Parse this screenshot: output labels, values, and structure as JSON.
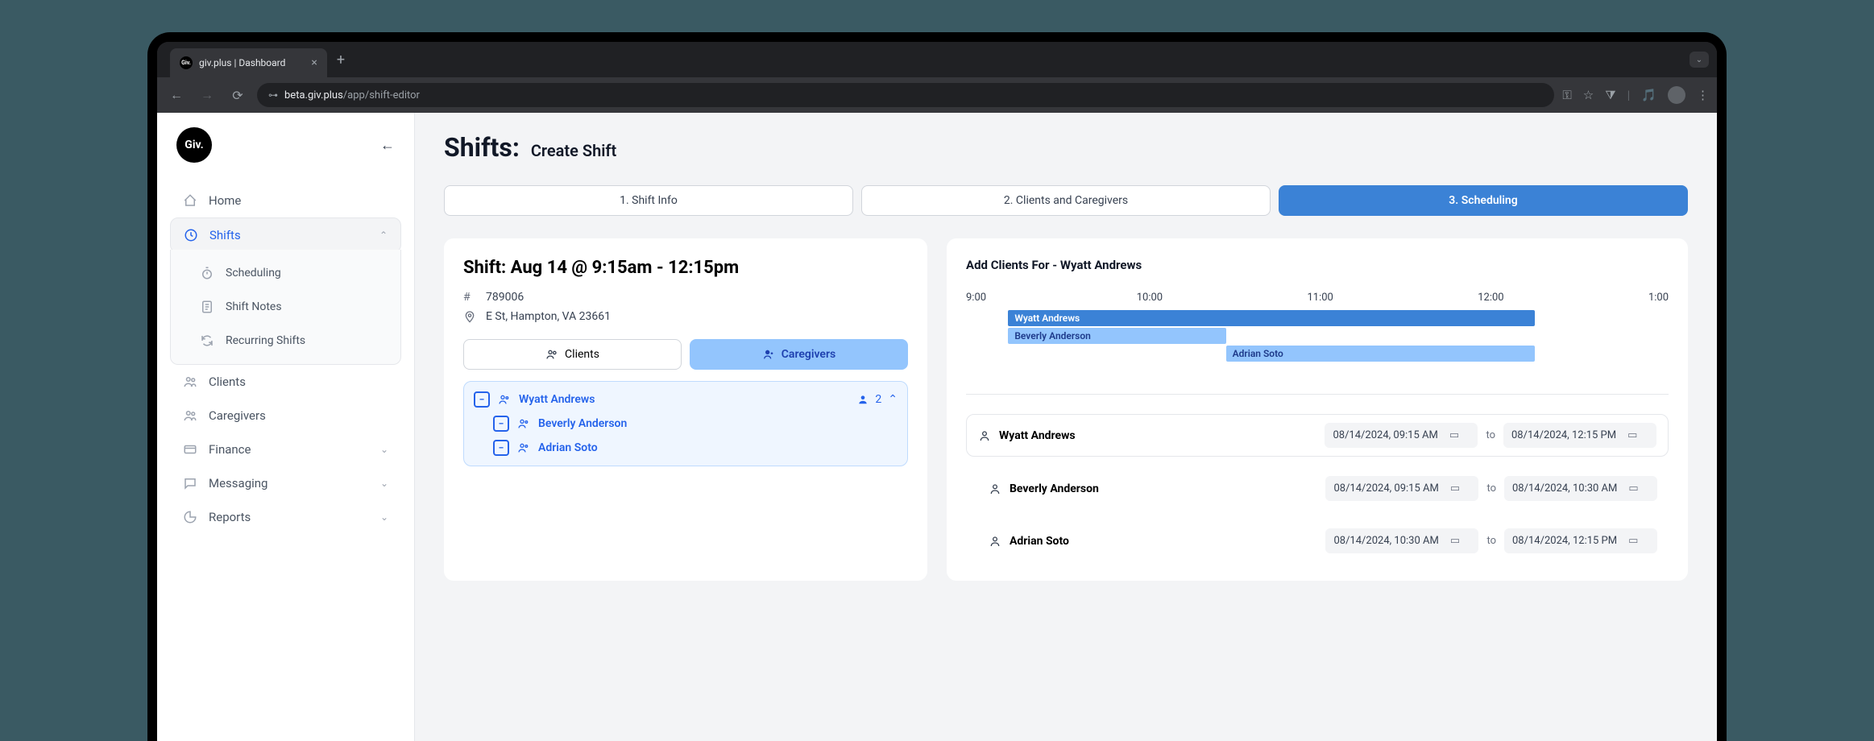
{
  "browser": {
    "tab_title": "giv.plus | Dashboard",
    "url_host": "beta.giv.plus",
    "url_path": "/app/shift-editor"
  },
  "logo_text": "Giv.",
  "sidebar": {
    "items": [
      {
        "label": "Home"
      },
      {
        "label": "Shifts"
      },
      {
        "label": "Clients"
      },
      {
        "label": "Caregivers"
      },
      {
        "label": "Finance"
      },
      {
        "label": "Messaging"
      },
      {
        "label": "Reports"
      }
    ],
    "shifts_sub": [
      {
        "label": "Scheduling"
      },
      {
        "label": "Shift Notes"
      },
      {
        "label": "Recurring Shifts"
      }
    ]
  },
  "page": {
    "title": "Shifts:",
    "subtitle": "Create Shift"
  },
  "steps": [
    {
      "label": "1. Shift Info"
    },
    {
      "label": "2. Clients and Caregivers"
    },
    {
      "label": "3. Scheduling"
    }
  ],
  "shift": {
    "title": "Shift: Aug 14 @ 9:15am - 12:15pm",
    "id": "789006",
    "address": "E St, Hampton, VA 23661"
  },
  "toggle": {
    "clients": "Clients",
    "caregivers": "Caregivers"
  },
  "group": {
    "lead": "Wyatt Andrews",
    "count": "2",
    "members": [
      {
        "name": "Beverly Anderson"
      },
      {
        "name": "Adrian Soto"
      }
    ]
  },
  "right": {
    "title": "Add Clients For - Wyatt Andrews",
    "time_labels": [
      "9:00",
      "10:00",
      "11:00",
      "12:00",
      "1:00"
    ],
    "bars": [
      {
        "name": "Wyatt Andrews"
      },
      {
        "name": "Beverly Anderson"
      },
      {
        "name": "Adrian Soto"
      }
    ]
  },
  "time_rows": [
    {
      "name": "Wyatt Andrews",
      "start": "08/14/2024, 09:15 AM",
      "to": "to",
      "end": "08/14/2024, 12:15 PM"
    },
    {
      "name": "Beverly Anderson",
      "start": "08/14/2024, 09:15 AM",
      "to": "to",
      "end": "08/14/2024, 10:30 AM"
    },
    {
      "name": "Adrian Soto",
      "start": "08/14/2024, 10:30 AM",
      "to": "to",
      "end": "08/14/2024, 12:15 PM"
    }
  ]
}
